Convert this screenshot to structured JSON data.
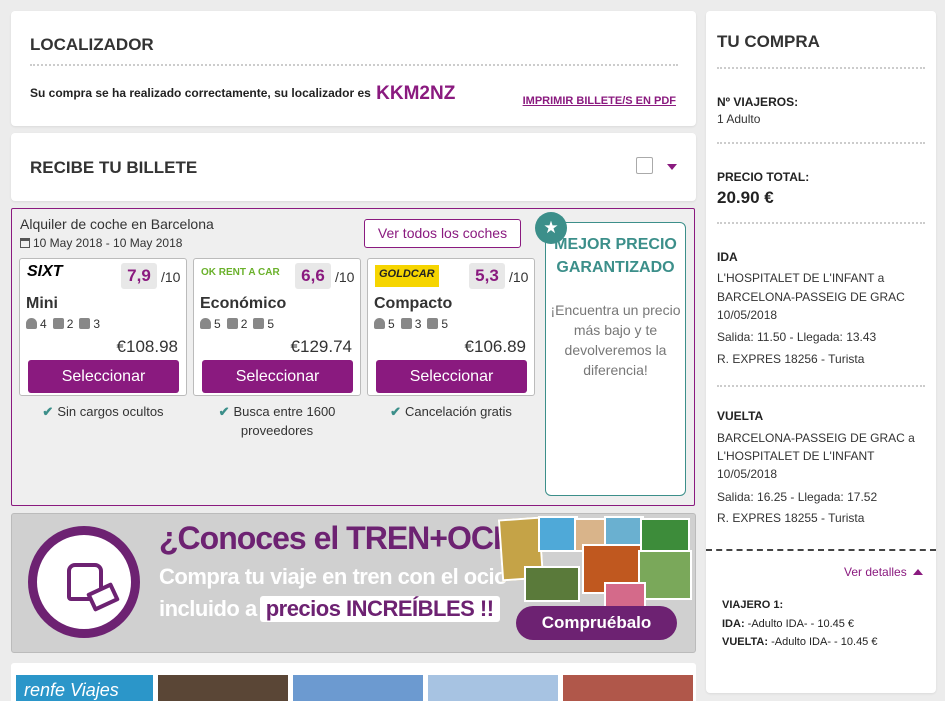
{
  "localizador": {
    "title": "LOCALIZADOR",
    "message": "Su compra se ha realizado correctamente, su localizador es",
    "code": "KKM2NZ",
    "print_label": "IMPRIMIR BILLETE/S EN PDF"
  },
  "recibe": {
    "title": "RECIBE TU BILLETE"
  },
  "cars": {
    "title": "Alquiler de coche en Barcelona",
    "dates": "10 May 2018 -  10 May 2018",
    "all_label": "Ver todos los coches",
    "outof": "/10",
    "select_label": "Seleccionar",
    "offers": [
      {
        "brand": "SIXT",
        "score": "7,9",
        "category": "Mini",
        "seats": "4",
        "bags": "2",
        "doors": "3",
        "price": "€108.98"
      },
      {
        "brand": "OK RENT A CAR",
        "score": "6,6",
        "category": "Económico",
        "seats": "5",
        "bags": "2",
        "doors": "5",
        "price": "€129.74"
      },
      {
        "brand": "GOLDCAR",
        "score": "5,3",
        "category": "Compacto",
        "seats": "5",
        "bags": "3",
        "doors": "5",
        "price": "€106.89"
      }
    ],
    "features": [
      "Sin cargos ocultos",
      "Busca entre 1600 proveedores",
      "Cancelación gratis"
    ],
    "best_price": {
      "heading": "MEJOR PRECIO GARANTIZADO",
      "body": "¡Encuentra un precio más bajo y te devolveremos la diferencia!"
    }
  },
  "banner": {
    "line1": "¿Conoces el TREN+OCIO?",
    "line2": "Compra tu viaje en tren con el ocio",
    "line3_a": "incluido a",
    "line3_b": "precios INCREÍBLES !!",
    "cta": "Compruébalo"
  },
  "strip": {
    "renfe": "renfe Viajes"
  },
  "sidebar": {
    "title": "TU COMPRA",
    "viajeros_label": "Nº VIAJEROS:",
    "viajeros_value": "1 Adulto",
    "total_label": "PRECIO TOTAL:",
    "total_value": "20.90 €",
    "ida": {
      "label": "IDA",
      "l1": "L'HOSPITALET DE L'INFANT a",
      "l2": "BARCELONA-PASSEIG DE GRAC",
      "l3": "10/05/2018",
      "l4": "Salida: 11.50 - Llegada: 13.43",
      "l5": "R. EXPRES 18256 - Turista"
    },
    "vuelta": {
      "label": "VUELTA",
      "l1": "BARCELONA-PASSEIG DE GRAC a",
      "l2": "L'HOSPITALET DE L'INFANT",
      "l3": "10/05/2018",
      "l4": "Salida: 16.25 - Llegada: 17.52",
      "l5": "R. EXPRES 18255 - Turista"
    },
    "details_label": "Ver detalles",
    "viajero_label": "VIAJERO 1:",
    "ida_key": "IDA:",
    "ida_val": " -Adulto IDA- - 10.45 €",
    "vuelta_key": "VUELTA:",
    "vuelta_val": " -Adulto IDA- - 10.45 €"
  },
  "colors": {
    "accent": "#8a1a7f",
    "teal": "#3c8f8a",
    "banner_purple": "#6d2272"
  }
}
